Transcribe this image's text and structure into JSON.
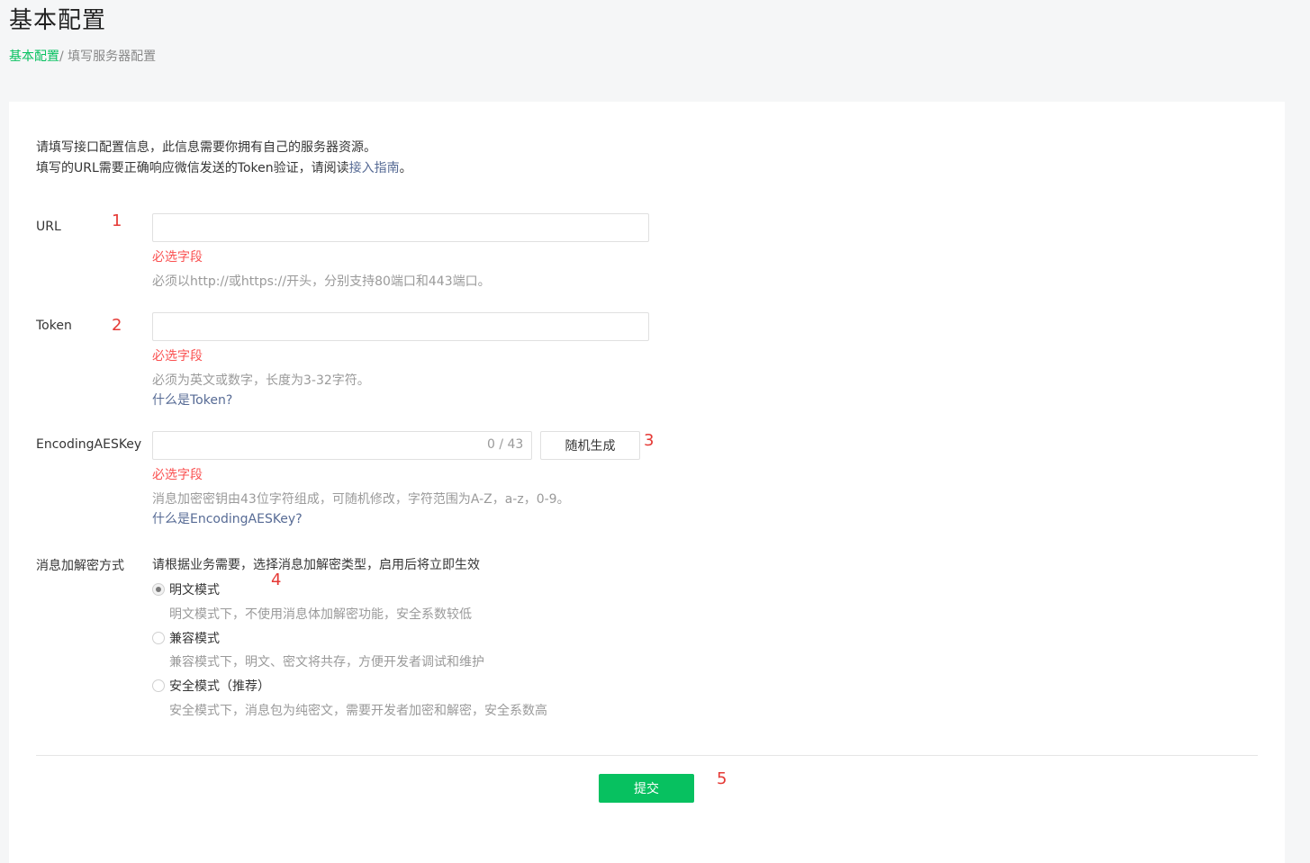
{
  "header": {
    "title": "基本配置",
    "breadcrumb": {
      "link": "基本配置",
      "separator": "/ ",
      "current": "填写服务器配置"
    }
  },
  "intro": {
    "line1": "请填写接口配置信息，此信息需要你拥有自己的服务器资源。",
    "line2_prefix": "填写的URL需要正确响应微信发送的Token验证，请阅读",
    "line2_link": "接入指南",
    "line2_suffix": "。"
  },
  "markers": [
    "1",
    "2",
    "3",
    "4",
    "5"
  ],
  "url_field": {
    "label": "URL",
    "value": "",
    "error": "必选字段",
    "hint": "必须以http://或https://开头，分别支持80端口和443端口。"
  },
  "token_field": {
    "label": "Token",
    "value": "",
    "error": "必选字段",
    "hint": "必须为英文或数字，长度为3-32字符。",
    "help_link": "什么是Token?"
  },
  "aes_field": {
    "label": "EncodingAESKey",
    "value": "",
    "counter": "0 / 43",
    "generate_button": "随机生成",
    "error": "必选字段",
    "hint": "消息加密密钥由43位字符组成，可随机修改，字符范围为A-Z，a-z，0-9。",
    "help_link": "什么是EncodingAESKey?"
  },
  "encryption": {
    "label": "消息加解密方式",
    "description": "请根据业务需要，选择消息加解密类型，启用后将立即生效",
    "options": [
      {
        "label": "明文模式",
        "hint": "明文模式下，不使用消息体加解密功能，安全系数较低",
        "checked": true
      },
      {
        "label": "兼容模式",
        "hint": "兼容模式下，明文、密文将共存，方便开发者调试和维护",
        "checked": false
      },
      {
        "label": "安全模式（推荐）",
        "hint": "安全模式下，消息包为纯密文，需要开发者加密和解密，安全系数高",
        "checked": false
      }
    ]
  },
  "submit_button": "提交",
  "colors": {
    "accent": "#07c160",
    "error": "#fa5151",
    "link": "#576b95",
    "marker": "#e53935"
  }
}
